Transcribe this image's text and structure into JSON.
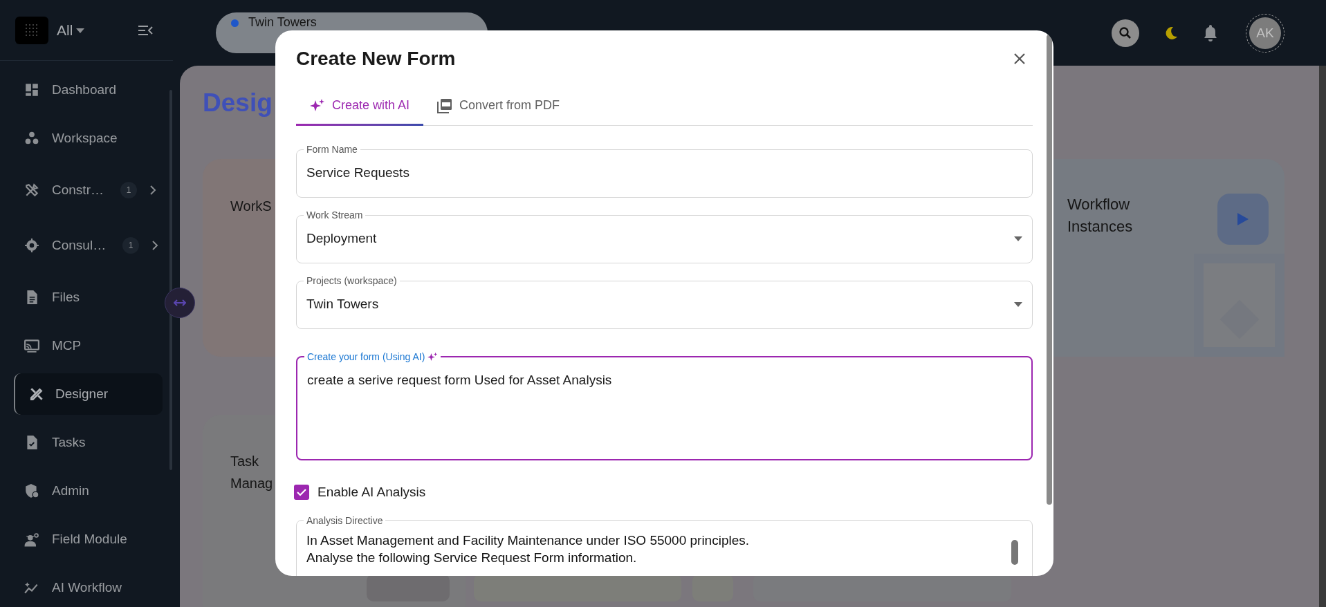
{
  "sidebar": {
    "scope": "All",
    "items": [
      {
        "label": "Dashboard",
        "selected": false
      },
      {
        "label": "Workspace",
        "selected": false
      },
      {
        "label": "Constr…",
        "badge": "1",
        "selected": false
      },
      {
        "label": "Consul…",
        "badge": "1",
        "selected": false
      },
      {
        "label": "Files",
        "selected": false
      },
      {
        "label": "MCP",
        "selected": false
      },
      {
        "label": "Designer",
        "selected": true
      },
      {
        "label": "Tasks",
        "selected": false
      },
      {
        "label": "Admin",
        "selected": false
      },
      {
        "label": "Field Module",
        "selected": false
      },
      {
        "label": "AI Workflow",
        "selected": false
      }
    ]
  },
  "topbar": {
    "project": "Twin Towers",
    "avatar": "AK"
  },
  "page": {
    "title": "Desig",
    "cards": [
      {
        "title": "WorkS"
      },
      {
        "title": "Workflow Instances"
      },
      {
        "title": "Task Manag"
      }
    ]
  },
  "dialog": {
    "title": "Create New Form",
    "tabs": [
      {
        "label": "Create with AI",
        "selected": true
      },
      {
        "label": "Convert from PDF",
        "selected": false
      }
    ],
    "fields": [
      {
        "kind": "text",
        "label": "Form Name",
        "value": "Service Requests"
      },
      {
        "kind": "select",
        "label": "Work Stream",
        "value": "Deployment"
      },
      {
        "kind": "select",
        "label": "Projects (workspace)",
        "value": "Twin Towers"
      },
      {
        "kind": "textarea",
        "label": "Create your form (Using AI)",
        "value": "create a serive request form Used for Asset Analysis",
        "focused": true
      }
    ],
    "checkbox": {
      "label": "Enable AI Analysis",
      "checked": true
    },
    "directive": {
      "label": "Analysis Directive",
      "lines": [
        "In Asset Management and Facility Maintenance under ISO 55000 principles.",
        "Analyse the following Service Request Form information."
      ]
    }
  }
}
